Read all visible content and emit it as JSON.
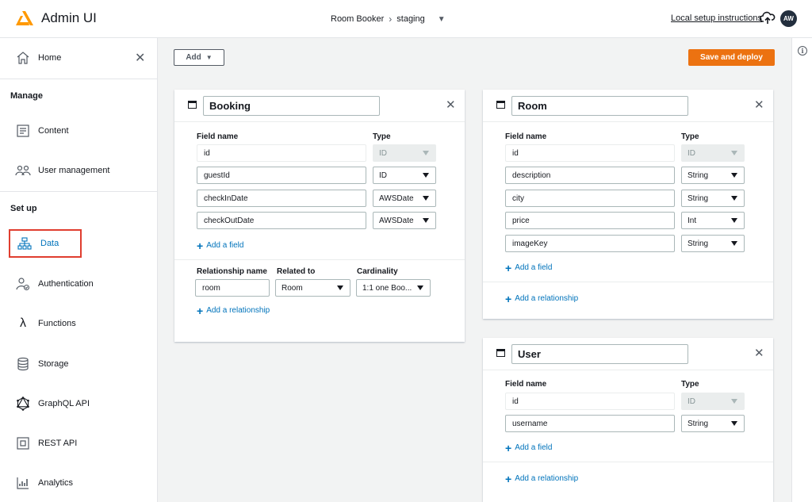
{
  "header": {
    "app_title": "Admin UI",
    "project": "Room Booker",
    "environment": "staging",
    "local_setup": "Local setup instructions",
    "avatar": "AW",
    "accent": "#ec7211"
  },
  "sidebar": {
    "home": "Home",
    "manage_section": "Manage",
    "content": "Content",
    "user_management": "User management",
    "setup_section": "Set up",
    "data": "Data",
    "authentication": "Authentication",
    "functions": "Functions",
    "storage": "Storage",
    "graphql": "GraphQL API",
    "rest": "REST API",
    "analytics": "Analytics"
  },
  "toolbar": {
    "add_label": "Add",
    "save_label": "Save and deploy"
  },
  "labels": {
    "field_name": "Field name",
    "type": "Type",
    "add_field": "Add a field",
    "add_relationship": "Add a relationship",
    "relationship_name": "Relationship name",
    "related_to": "Related to",
    "cardinality": "Cardinality"
  },
  "booking": {
    "name": "Booking",
    "fields": [
      {
        "name": "id",
        "type": "ID"
      },
      {
        "name": "guestId",
        "type": "ID"
      },
      {
        "name": "checkInDate",
        "type": "AWSDate"
      },
      {
        "name": "checkOutDate",
        "type": "AWSDate"
      }
    ],
    "relationship": {
      "name": "room",
      "related_to": "Room",
      "cardinality": "1:1 one Boo..."
    }
  },
  "room": {
    "name": "Room",
    "fields": [
      {
        "name": "id",
        "type": "ID"
      },
      {
        "name": "description",
        "type": "String"
      },
      {
        "name": "city",
        "type": "String"
      },
      {
        "name": "price",
        "type": "Int"
      },
      {
        "name": "imageKey",
        "type": "String"
      }
    ]
  },
  "user": {
    "name": "User",
    "fields": [
      {
        "name": "id",
        "type": "ID"
      },
      {
        "name": "username",
        "type": "String"
      }
    ]
  }
}
